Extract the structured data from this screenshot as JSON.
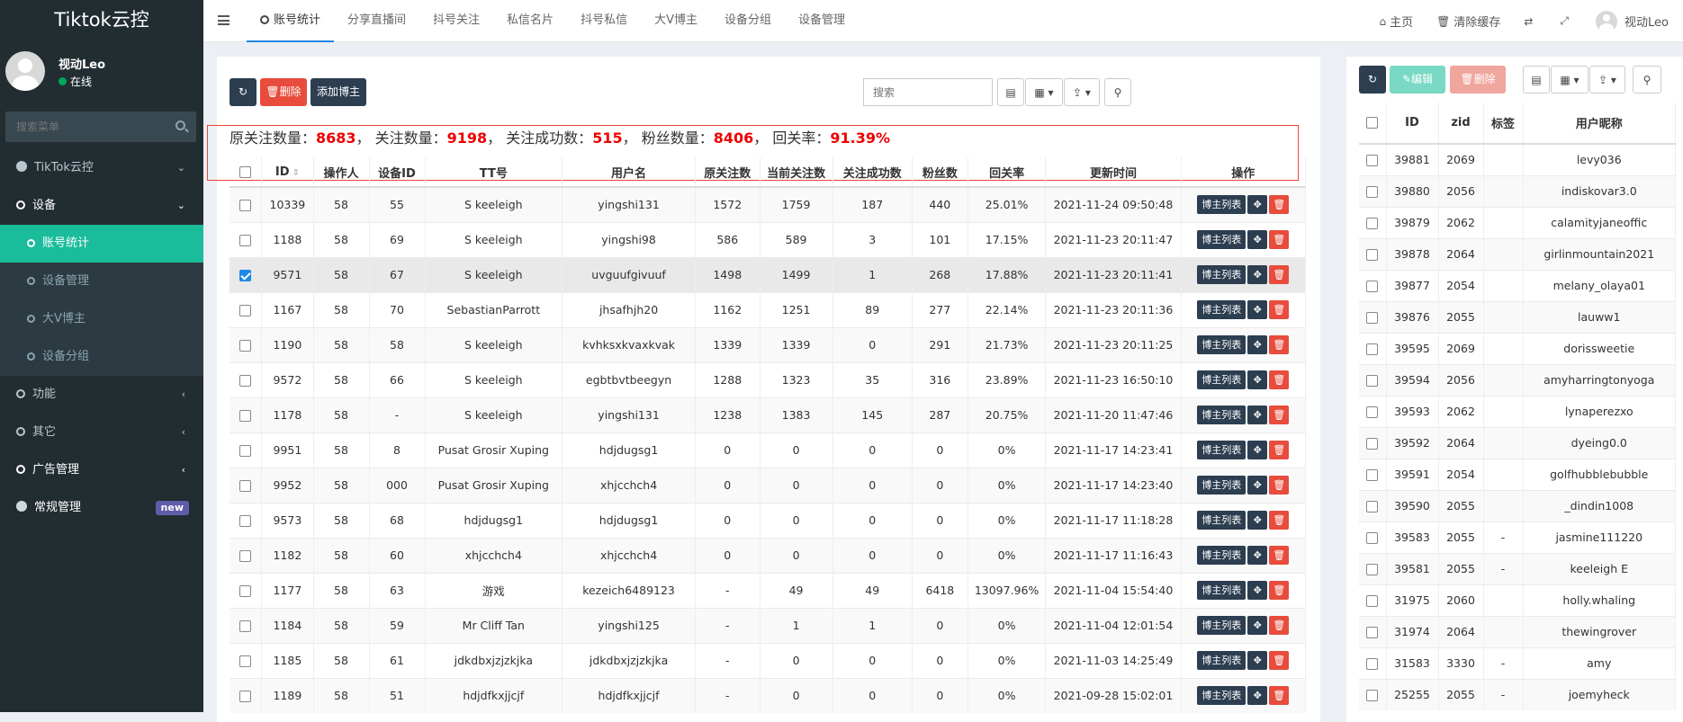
{
  "app": {
    "title": "Tiktok云控"
  },
  "user": {
    "name": "视动Leo",
    "status": "在线"
  },
  "sidebar": {
    "search_placeholder": "搜索菜单",
    "items": [
      {
        "label": "TikTok云控"
      },
      {
        "label": "设备"
      },
      {
        "label": "账号统计"
      },
      {
        "label": "设备管理"
      },
      {
        "label": "大V博主"
      },
      {
        "label": "设备分组"
      },
      {
        "label": "功能"
      },
      {
        "label": "其它"
      },
      {
        "label": "广告管理"
      },
      {
        "label": "常规管理"
      }
    ],
    "new_badge": "new"
  },
  "tabs": [
    "账号统计",
    "分享直播间",
    "抖号关注",
    "私信名片",
    "抖号私信",
    "大V博主",
    "设备分组",
    "设备管理"
  ],
  "topright": {
    "home": "主页",
    "clear_cache": "清除缓存",
    "user": "视动Leo"
  },
  "toolbar": {
    "delete": "删除",
    "add_host": "添加博主",
    "search_placeholder": "搜索"
  },
  "summary": {
    "l1": "原关注数量：",
    "v1": "8683",
    "l2": "， 关注数量：",
    "v2": "9198",
    "l3": "， 关注成功数：",
    "v3": "515",
    "l4": "， 粉丝数量：",
    "v4": "8406",
    "l5": "， 回关率：",
    "v5": "91.39%"
  },
  "table": {
    "headers": [
      "ID",
      "操作人",
      "设备ID",
      "TT号",
      "用户名",
      "原关注数",
      "当前关注数",
      "关注成功数",
      "粉丝数",
      "回关率",
      "更新时间",
      "操作"
    ],
    "action_label": "博主列表",
    "rows": [
      [
        "10339",
        "58",
        "55",
        "S keeleigh",
        "yingshi131",
        "1572",
        "1759",
        "187",
        "440",
        "25.01%",
        "2021-11-24 09:50:48"
      ],
      [
        "1188",
        "58",
        "69",
        "S keeleigh",
        "yingshi98",
        "586",
        "589",
        "3",
        "101",
        "17.15%",
        "2021-11-23 20:11:47"
      ],
      [
        "9571",
        "58",
        "67",
        "S keeleigh",
        "uvguufgivuuf",
        "1498",
        "1499",
        "1",
        "268",
        "17.88%",
        "2021-11-23 20:11:41"
      ],
      [
        "1167",
        "58",
        "70",
        "SebastianParrott",
        "jhsafhjh20",
        "1162",
        "1251",
        "89",
        "277",
        "22.14%",
        "2021-11-23 20:11:36"
      ],
      [
        "1190",
        "58",
        "58",
        "S keeleigh",
        "kvhksxkvaxkvak",
        "1339",
        "1339",
        "0",
        "291",
        "21.73%",
        "2021-11-23 20:11:25"
      ],
      [
        "9572",
        "58",
        "66",
        "S keeleigh",
        "egbtbvtbeegyn",
        "1288",
        "1323",
        "35",
        "316",
        "23.89%",
        "2021-11-23 16:50:10"
      ],
      [
        "1178",
        "58",
        "-",
        "S keeleigh",
        "yingshi131",
        "1238",
        "1383",
        "145",
        "287",
        "20.75%",
        "2021-11-20 11:47:46"
      ],
      [
        "9951",
        "58",
        "8",
        "Pusat Grosir Xuping",
        "hdjdugsg1",
        "0",
        "0",
        "0",
        "0",
        "0%",
        "2021-11-17 14:23:41"
      ],
      [
        "9952",
        "58",
        "000",
        "Pusat Grosir Xuping",
        "xhjcchch4",
        "0",
        "0",
        "0",
        "0",
        "0%",
        "2021-11-17 14:23:40"
      ],
      [
        "9573",
        "58",
        "68",
        "hdjdugsg1",
        "hdjdugsg1",
        "0",
        "0",
        "0",
        "0",
        "0%",
        "2021-11-17 11:18:28"
      ],
      [
        "1182",
        "58",
        "60",
        "xhjcchch4",
        "xhjcchch4",
        "0",
        "0",
        "0",
        "0",
        "0%",
        "2021-11-17 11:16:43"
      ],
      [
        "1177",
        "58",
        "63",
        "游戏",
        "kezeich6489123",
        "-",
        "49",
        "49",
        "6418",
        "13097.96%",
        "2021-11-04 15:54:40"
      ],
      [
        "1184",
        "58",
        "59",
        "Mr Cliff Tan",
        "yingshi125",
        "-",
        "1",
        "1",
        "0",
        "0%",
        "2021-11-04 12:01:54"
      ],
      [
        "1185",
        "58",
        "61",
        "jdkdbxjzjzkjka",
        "jdkdbxjzjzkjka",
        "-",
        "0",
        "0",
        "0",
        "0%",
        "2021-11-03 14:25:49"
      ],
      [
        "1189",
        "58",
        "51",
        "hdjdfkxjjcjf",
        "hdjdfkxjjcjf",
        "-",
        "0",
        "0",
        "0",
        "0%",
        "2021-09-28 15:02:01"
      ]
    ]
  },
  "side": {
    "edit": "编辑",
    "delete": "删除",
    "headers": [
      "ID",
      "zid",
      "标签",
      "用户昵称"
    ],
    "rows": [
      [
        "39881",
        "2069",
        "",
        "levy036"
      ],
      [
        "39880",
        "2056",
        "",
        "indiskovar3.0"
      ],
      [
        "39879",
        "2062",
        "",
        "calamityjaneoffic"
      ],
      [
        "39878",
        "2064",
        "",
        "girlinmountain2021"
      ],
      [
        "39877",
        "2054",
        "",
        "melany_olaya01"
      ],
      [
        "39876",
        "2055",
        "",
        "lauww1"
      ],
      [
        "39595",
        "2069",
        "",
        "dorissweetie"
      ],
      [
        "39594",
        "2056",
        "",
        "amyharringtonyoga"
      ],
      [
        "39593",
        "2062",
        "",
        "lynaperezxo"
      ],
      [
        "39592",
        "2064",
        "",
        "dyeing0.0"
      ],
      [
        "39591",
        "2054",
        "",
        "golfhubblebubble"
      ],
      [
        "39590",
        "2055",
        "",
        "_dindin1008"
      ],
      [
        "39583",
        "2055",
        "-",
        "jasmine111220"
      ],
      [
        "39581",
        "2055",
        "-",
        "keeleigh E"
      ],
      [
        "31975",
        "2060",
        "",
        "holly.whaling"
      ],
      [
        "31974",
        "2064",
        "",
        "thewingrover"
      ],
      [
        "31583",
        "3330",
        "-",
        "amy"
      ],
      [
        "25255",
        "2055",
        "-",
        "joemyheck"
      ]
    ]
  }
}
